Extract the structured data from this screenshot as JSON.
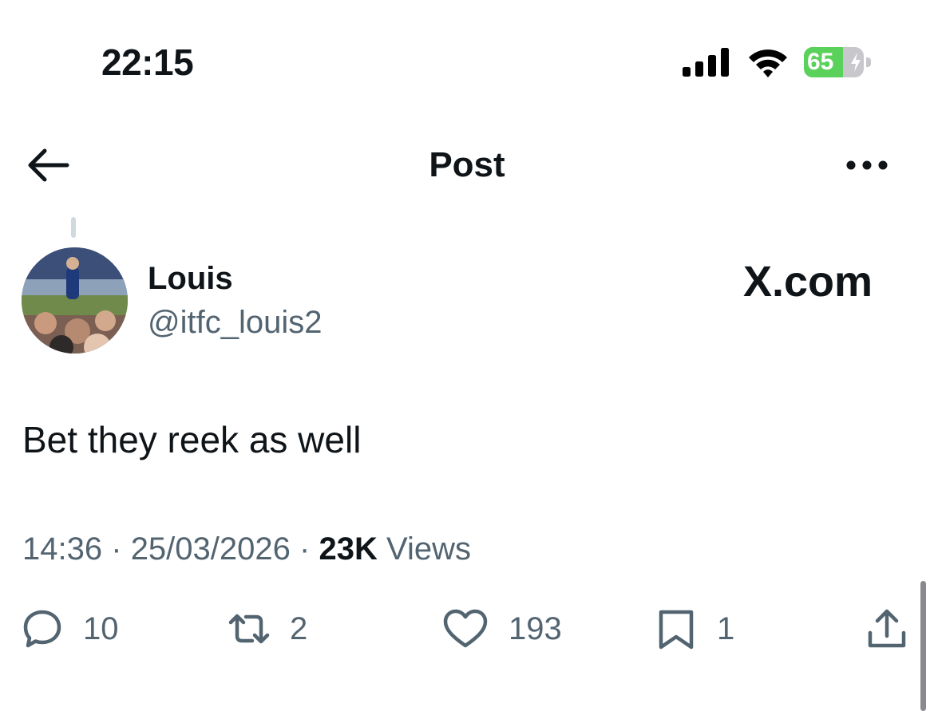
{
  "status_bar": {
    "time": "22:15",
    "battery_level": 65,
    "battery_text": "65",
    "charging": true
  },
  "header": {
    "title": "Post"
  },
  "post": {
    "author": {
      "name": "Louis",
      "handle": "@itfc_louis2"
    },
    "watermark": "X.com",
    "text": "Bet they reek as well",
    "time": "14:36",
    "date": "25/03/2026",
    "views_count": "23K",
    "views_label": "Views",
    "separator": "·"
  },
  "actions": {
    "replies": "10",
    "reposts": "2",
    "likes": "193",
    "bookmarks": "1"
  },
  "icons": {
    "back": "arrow-left-icon",
    "more": "more-horizontal-icon",
    "reply": "speech-bubble-icon",
    "repost": "repost-icon",
    "like": "heart-icon",
    "bookmark": "bookmark-icon",
    "share": "share-icon"
  },
  "colors": {
    "text": "#0f1419",
    "secondary": "#536471",
    "battery_green": "#5ad15a"
  }
}
